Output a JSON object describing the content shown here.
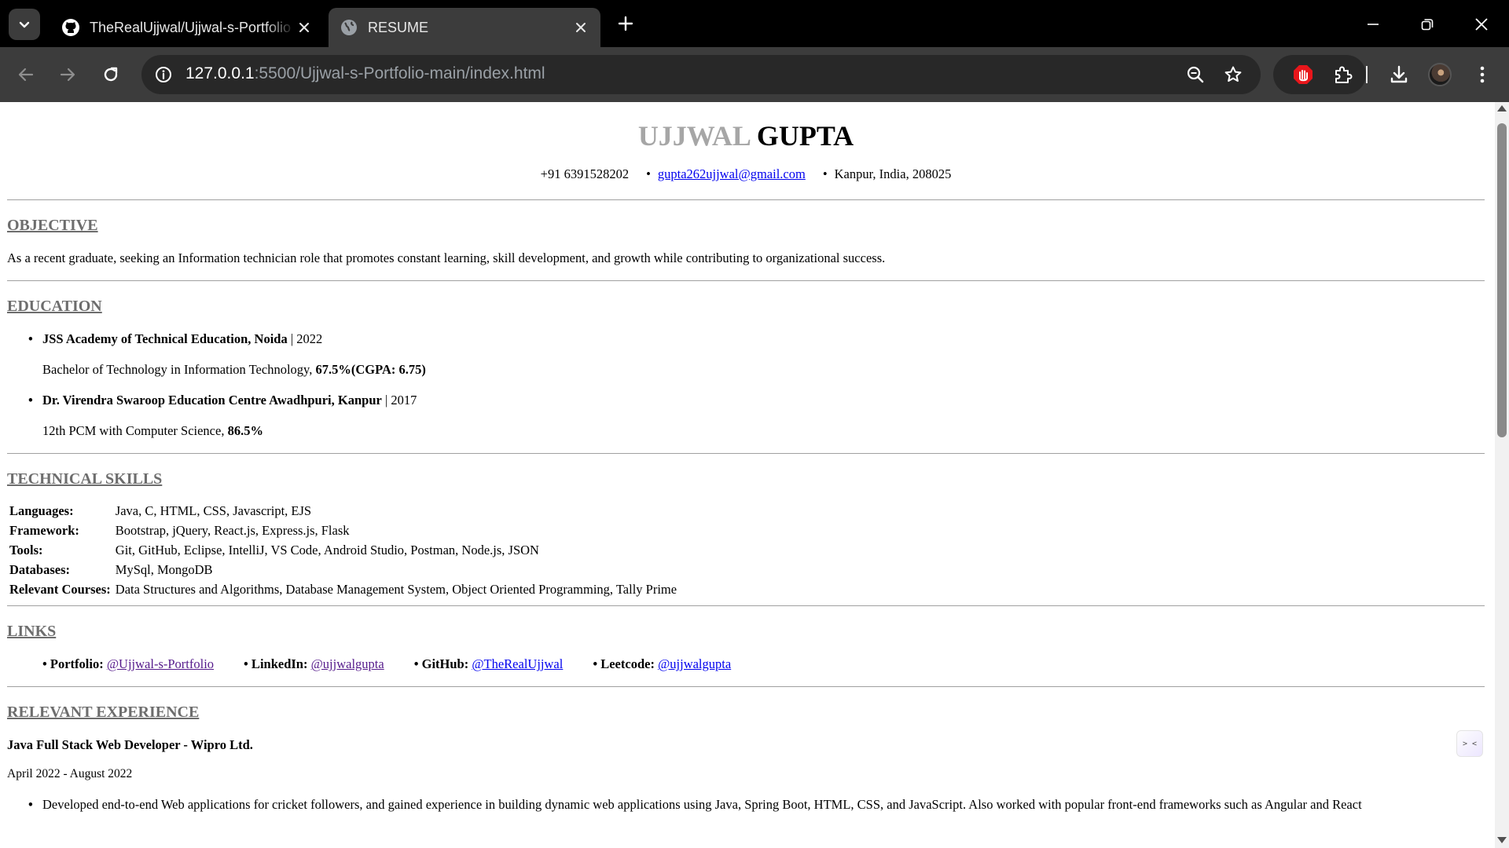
{
  "browser": {
    "tabs": [
      {
        "title": "TheRealUjjwal/Ujjwal-s-Portfolio",
        "favicon": "github-icon",
        "active": false
      },
      {
        "title": "RESUME",
        "favicon": "globe-icon",
        "active": true
      }
    ],
    "url_host": "127.0.0.1",
    "url_path": ":5500/Ujjwal-s-Portfolio-main/index.html",
    "colors": {
      "tabstrip": "#000000",
      "toolbar": "#3c3c3c",
      "omnibox": "#282828",
      "extension_red": "#e8161b"
    }
  },
  "resume": {
    "name_first": "UJJWAL",
    "name_last": "GUPTA",
    "contact": {
      "phone": "+91 6391528202",
      "bullet": "•",
      "email": "gupta262ujjwal@gmail.com",
      "location": "Kanpur, India, 208025"
    },
    "objective": {
      "heading": "OBJECTIVE",
      "text": "As a recent graduate, seeking an Information technician role that promotes constant learning, skill development, and growth while contributing to organizational success."
    },
    "education": {
      "heading": "EDUCATION",
      "items": [
        {
          "school": "JSS Academy of Technical Education, Noida",
          "year": " | 2022",
          "degree": "Bachelor of Technology in Information Technology, ",
          "score": "67.5%(CGPA: 6.75)"
        },
        {
          "school": "Dr. Virendra Swaroop Education Centre Awadhpuri, Kanpur",
          "year": " | 2017",
          "degree": "12th PCM with Computer Science, ",
          "score": "86.5%"
        }
      ]
    },
    "skills": {
      "heading": "TECHNICAL SKILLS",
      "rows": [
        {
          "label": "Languages:",
          "value": "Java, C, HTML, CSS, Javascript, EJS"
        },
        {
          "label": "Framework:",
          "value": "Bootstrap, jQuery, React.js, Express.js, Flask"
        },
        {
          "label": "Tools:",
          "value": "Git, GitHub, Eclipse, IntelliJ, VS Code, Android Studio, Postman, Node.js, JSON"
        },
        {
          "label": "Databases:",
          "value": "MySql, MongoDB"
        },
        {
          "label": "Relevant Courses:",
          "value": "Data Structures and Algorithms, Database Management System, Object Oriented Programming, Tally Prime"
        }
      ]
    },
    "links": {
      "heading": "LINKS",
      "items": [
        {
          "label": "• Portfolio:",
          "text": "@Ujjwal-s-Portfolio"
        },
        {
          "label": "• LinkedIn:",
          "text": "@ujjwalgupta"
        },
        {
          "label": "• GitHub:",
          "text": "@TheRealUjjwal"
        },
        {
          "label": "• Leetcode:",
          "text": "@ujjwalgupta"
        }
      ]
    },
    "experience": {
      "heading": "RELEVANT EXPERIENCE",
      "role": "Java Full Stack Web Developer - Wipro Ltd.",
      "dates": "April 2022 - August 2022",
      "bullets": [
        "Developed end-to-end Web applications for cricket followers, and gained experience in building dynamic web applications using Java, Spring Boot, HTML, CSS, and JavaScript. Also worked with popular front-end frameworks such as Angular and React"
      ]
    },
    "side_widget": "> <"
  }
}
